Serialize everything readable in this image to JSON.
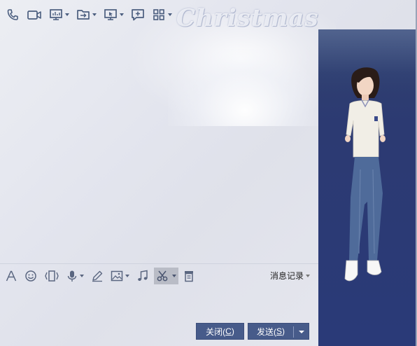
{
  "window": {
    "background_word": "Christmas"
  },
  "top_toolbar": {
    "items": [
      {
        "name": "phone-icon",
        "has_dropdown": false
      },
      {
        "name": "video-icon",
        "has_dropdown": false
      },
      {
        "name": "screen-share-icon",
        "has_dropdown": true
      },
      {
        "name": "file-transfer-icon",
        "has_dropdown": true
      },
      {
        "name": "remote-desktop-icon",
        "has_dropdown": true
      },
      {
        "name": "message-add-icon",
        "has_dropdown": false
      },
      {
        "name": "apps-grid-icon",
        "has_dropdown": true
      }
    ]
  },
  "edit_toolbar": {
    "items": [
      {
        "name": "font-icon"
      },
      {
        "name": "emoji-icon"
      },
      {
        "name": "shake-icon"
      },
      {
        "name": "voice-icon",
        "has_dropdown": true
      },
      {
        "name": "pen-icon"
      },
      {
        "name": "image-icon",
        "has_dropdown": true
      },
      {
        "name": "music-icon"
      },
      {
        "name": "scissors-icon",
        "has_dropdown": true,
        "active": true
      },
      {
        "name": "trash-icon"
      }
    ],
    "history_label": "消息记录"
  },
  "buttons": {
    "close_label": "关闭(",
    "close_key": "C",
    "close_end": ")",
    "send_label": "发送(",
    "send_key": "S",
    "send_end": ")"
  },
  "colors": {
    "accent": "#475b8a",
    "icon": "#4a5d7e",
    "panel": "#2c3a72"
  }
}
